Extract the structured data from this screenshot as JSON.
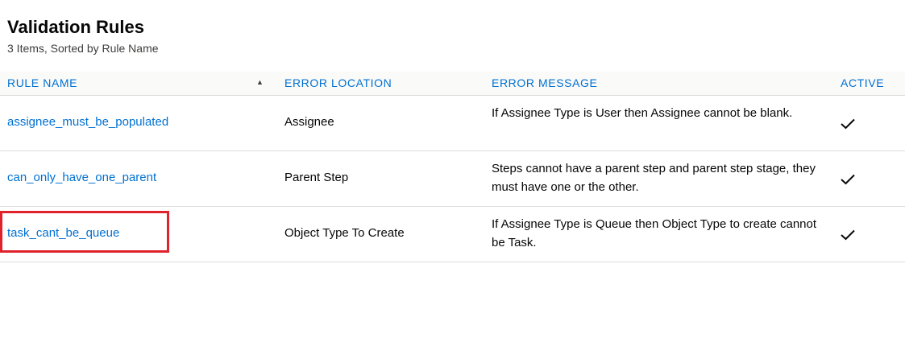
{
  "header": {
    "title": "Validation Rules",
    "subtitle": "3 Items, Sorted by Rule Name"
  },
  "table": {
    "columns": [
      {
        "label": "RULE NAME",
        "sorted": "ascending"
      },
      {
        "label": "ERROR LOCATION"
      },
      {
        "label": "ERROR MESSAGE"
      },
      {
        "label": "ACTIVE"
      }
    ],
    "rows": [
      {
        "rule_name": "assignee_must_be_populated",
        "error_location": "Assignee",
        "error_message": "If Assignee Type is User then Assignee cannot be blank.",
        "active": true
      },
      {
        "rule_name": "can_only_have_one_parent",
        "error_location": "Parent Step",
        "error_message": "Steps cannot have a parent step and parent step stage, they must have one or the other.",
        "active": true
      },
      {
        "rule_name": "task_cant_be_queue",
        "error_location": "Object Type To Create",
        "error_message": "If Assignee Type is Queue then Object Type to create cannot be Task.",
        "active": true,
        "highlighted": true
      }
    ]
  },
  "icons": {
    "sort": "sort-ascending-icon",
    "active": "checkmark-icon"
  },
  "colors": {
    "link": "#0070d2",
    "highlight": "#e0222b",
    "header_bg": "#fafaf9"
  }
}
